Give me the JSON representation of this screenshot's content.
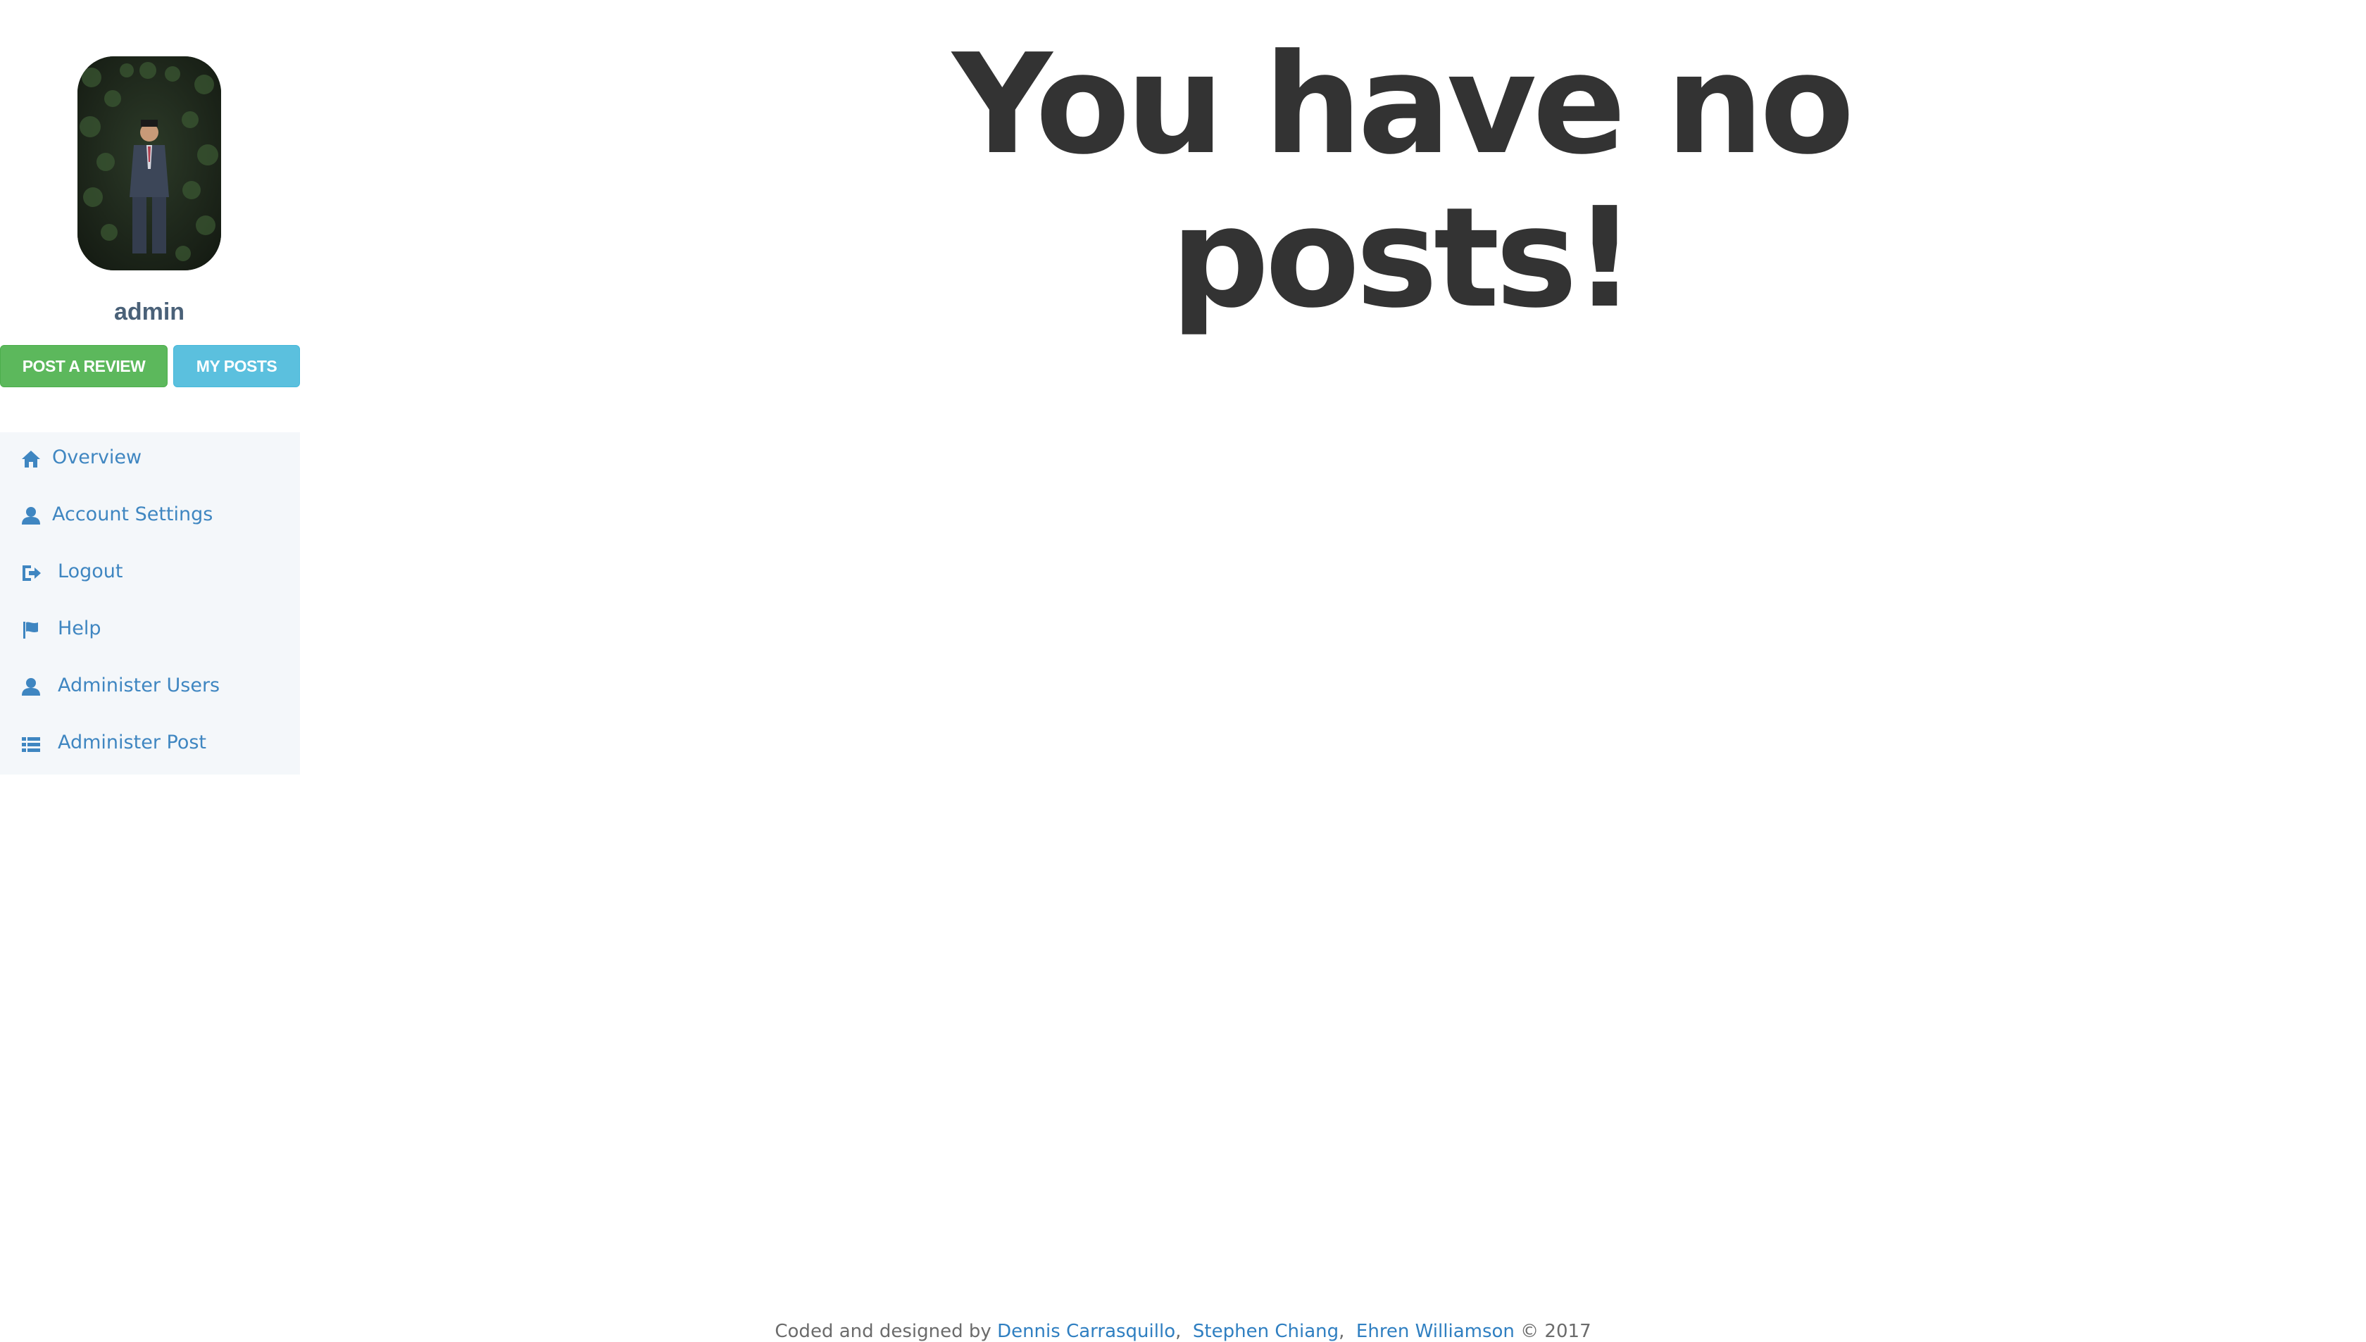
{
  "sidebar": {
    "username": "admin",
    "buttons": {
      "post_review": "POST A REVIEW",
      "my_posts": "MY POSTS"
    },
    "nav": [
      {
        "label": "Overview",
        "icon": "home-icon"
      },
      {
        "label": "Account Settings",
        "icon": "user-icon"
      },
      {
        "label": "Logout",
        "icon": "logout-icon"
      },
      {
        "label": "Help",
        "icon": "flag-icon"
      },
      {
        "label": "Administer Users",
        "icon": "user-icon"
      },
      {
        "label": "Administer Post",
        "icon": "list-icon"
      }
    ]
  },
  "main": {
    "headline_line1": "You have no",
    "headline_line2": "posts!"
  },
  "footer": {
    "prefix": "Coded and designed by",
    "authors": [
      "Dennis Carrasquillo",
      "Stephen Chiang",
      "Ehren Williamson"
    ],
    "suffix": "© 2017"
  },
  "colors": {
    "link": "#3f86c1",
    "green": "#5cb85c",
    "blue": "#5bc0de",
    "nav_bg": "#f4f7fa",
    "heading": "#333333"
  }
}
